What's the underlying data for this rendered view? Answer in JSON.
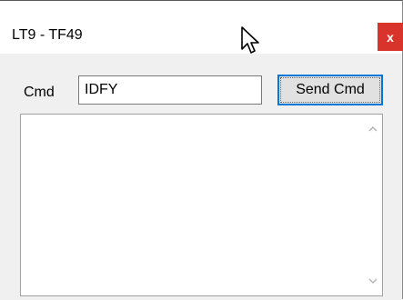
{
  "window": {
    "title": "LT9 - TF49",
    "close_label": "x"
  },
  "cmd": {
    "label": "Cmd",
    "value": "IDFY",
    "send_label": "Send Cmd"
  },
  "output": {
    "text": ""
  },
  "icons": {
    "close": "close-icon",
    "scroll_up": "chevron-up-icon",
    "scroll_down": "chevron-down-icon",
    "cursor": "mouse-pointer-icon"
  },
  "colors": {
    "close_bg": "#d9342b",
    "focus_border": "#0078d7",
    "client_bg": "#f0f0f0"
  }
}
